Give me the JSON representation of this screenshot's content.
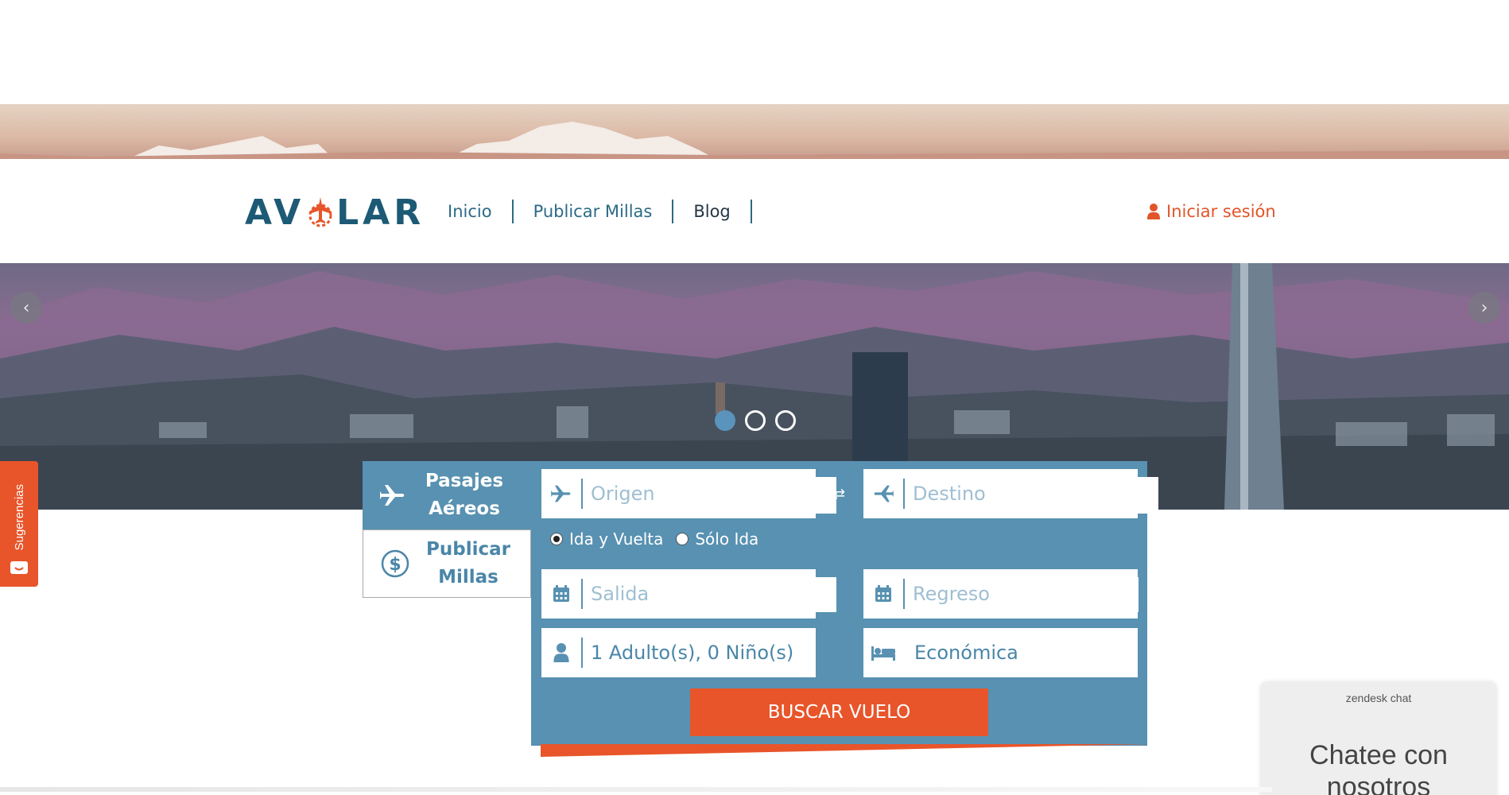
{
  "brand": {
    "logo_text_left": "AV",
    "logo_text_right": "LAR",
    "accent": "#e8552a",
    "primary": "#1d5a75",
    "panel": "#5891b1"
  },
  "nav": {
    "items": [
      {
        "label": "Inicio"
      },
      {
        "label": "Publicar Millas"
      },
      {
        "label": "Blog"
      }
    ]
  },
  "header": {
    "login_label": "Iniciar sesión"
  },
  "carousel": {
    "slide_count": 3,
    "active_index": 0
  },
  "sidebar_tab": {
    "label": "Sugerencias"
  },
  "search": {
    "tabs": [
      {
        "label": "Pasajes Aéreos",
        "icon": "plane-icon"
      },
      {
        "label": "Publicar Millas",
        "icon": "dollar-circle-icon"
      }
    ],
    "origen_placeholder": "Origen",
    "destino_placeholder": "Destino",
    "trip_options": [
      {
        "label": "Ida y Vuelta",
        "checked": true
      },
      {
        "label": "Sólo Ida",
        "checked": false
      }
    ],
    "salida_placeholder": "Salida",
    "regreso_placeholder": "Regreso",
    "passengers_value": "1 Adulto(s), 0 Niño(s)",
    "cabin_value": "Económica",
    "submit_label": "BUSCAR VUELO"
  },
  "chat": {
    "brand": "zendesk chat",
    "title_line1": "Chatee con",
    "title_line2": "nosotros"
  }
}
